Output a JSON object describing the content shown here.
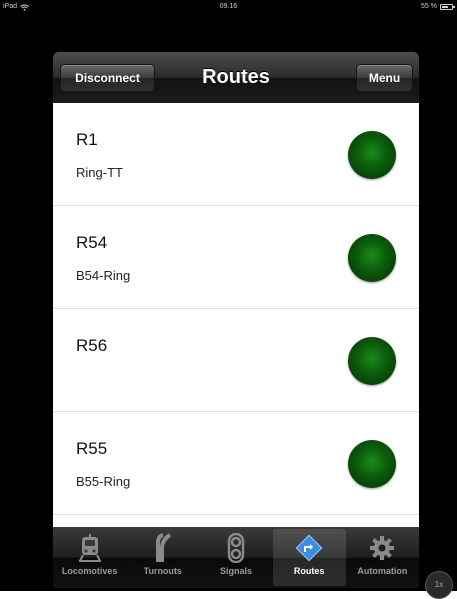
{
  "status_bar": {
    "device": "iPad",
    "time": "09.16",
    "battery": "55 %"
  },
  "navbar": {
    "left_button": "Disconnect",
    "title": "Routes",
    "right_button": "Menu"
  },
  "routes": [
    {
      "name": "R1",
      "description": "Ring-TT",
      "state_color": "#0b5a0b"
    },
    {
      "name": "R54",
      "description": "B54-Ring",
      "state_color": "#0b5a0b"
    },
    {
      "name": "R56",
      "description": "",
      "state_color": "#0b5a0b"
    },
    {
      "name": "R55",
      "description": "B55-Ring",
      "state_color": "#0b5a0b"
    }
  ],
  "tabs": [
    {
      "label": "Locomotives",
      "icon": "train-icon",
      "active": false
    },
    {
      "label": "Turnouts",
      "icon": "turnout-icon",
      "active": false
    },
    {
      "label": "Signals",
      "icon": "signal-icon",
      "active": false
    },
    {
      "label": "Routes",
      "icon": "route-sign-icon",
      "active": true
    },
    {
      "label": "Automation",
      "icon": "gear-icon",
      "active": false
    }
  ],
  "zoom_badge": "1x"
}
